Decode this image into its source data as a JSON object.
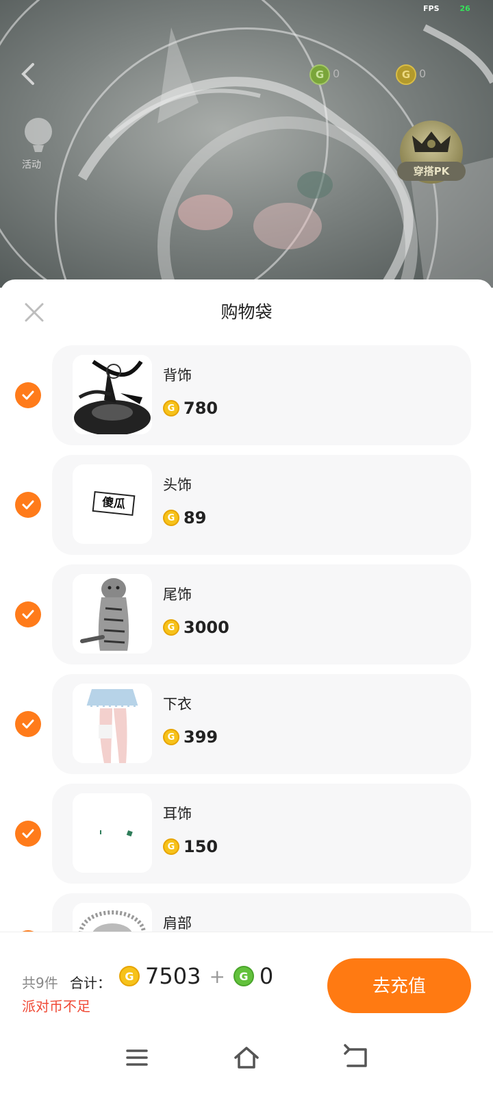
{
  "overlay": {
    "fps_label": "FPS",
    "fps_value": "26",
    "green_coin_balance": "0",
    "gold_coin_balance": "0",
    "activity_label": "活动",
    "pk_label": "穿搭PK"
  },
  "sheet": {
    "title": "购物袋",
    "items": [
      {
        "category": "背饰",
        "price": "780",
        "checked": true
      },
      {
        "category": "头饰",
        "price": "89",
        "checked": true,
        "sticker_text": "傻瓜"
      },
      {
        "category": "尾饰",
        "price": "3000",
        "checked": true
      },
      {
        "category": "下衣",
        "price": "399",
        "checked": true
      },
      {
        "category": "耳饰",
        "price": "150",
        "checked": true
      },
      {
        "category": "肩部",
        "price": "",
        "checked": true
      }
    ]
  },
  "footer": {
    "count_text": "共9件",
    "total_label": "合计：",
    "gold_total": "7503",
    "plus": "+",
    "green_total": "0",
    "warning": "派对币不足",
    "recharge_button": "去充值"
  },
  "colors": {
    "accent": "#ff7a12",
    "warning": "#f04a36",
    "gold_coin": "#f6c21a",
    "green_coin": "#62c13c"
  },
  "icons": {
    "coin_glyph": "G"
  }
}
